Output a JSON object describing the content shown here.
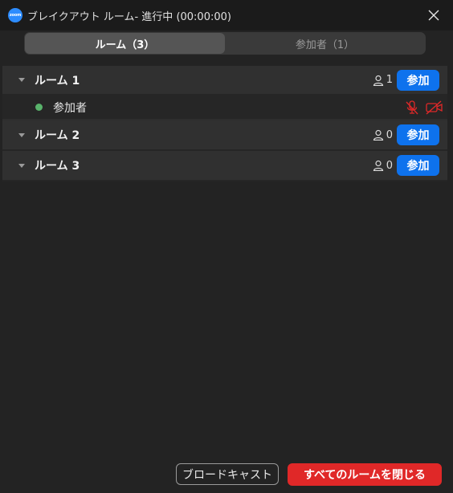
{
  "window": {
    "app_logo_text": "zoom",
    "title": "ブレイクアウト ルーム- 進行中 (00:00:00)"
  },
  "tabs": [
    {
      "label": "ルーム（3）",
      "active": true
    },
    {
      "label": "参加者（1）",
      "active": false
    }
  ],
  "rooms": [
    {
      "name": "ルーム 1",
      "count": "1",
      "join_label": "参加",
      "expanded": true,
      "participants": [
        {
          "name": "参加者",
          "mic": "muted",
          "video": "off"
        }
      ]
    },
    {
      "name": "ルーム 2",
      "count": "0",
      "join_label": "参加",
      "expanded": false
    },
    {
      "name": "ルーム 3",
      "count": "0",
      "join_label": "参加",
      "expanded": false
    }
  ],
  "footer": {
    "broadcast_label": "ブロードキャスト",
    "close_all_label": "すべてのルームを閉じる"
  },
  "colors": {
    "accent": "#0e72ed",
    "danger": "#e02828",
    "online": "#59b36b"
  },
  "icons": [
    "close-icon",
    "caret-down-icon",
    "person-icon",
    "mic-muted-icon",
    "video-off-icon"
  ]
}
